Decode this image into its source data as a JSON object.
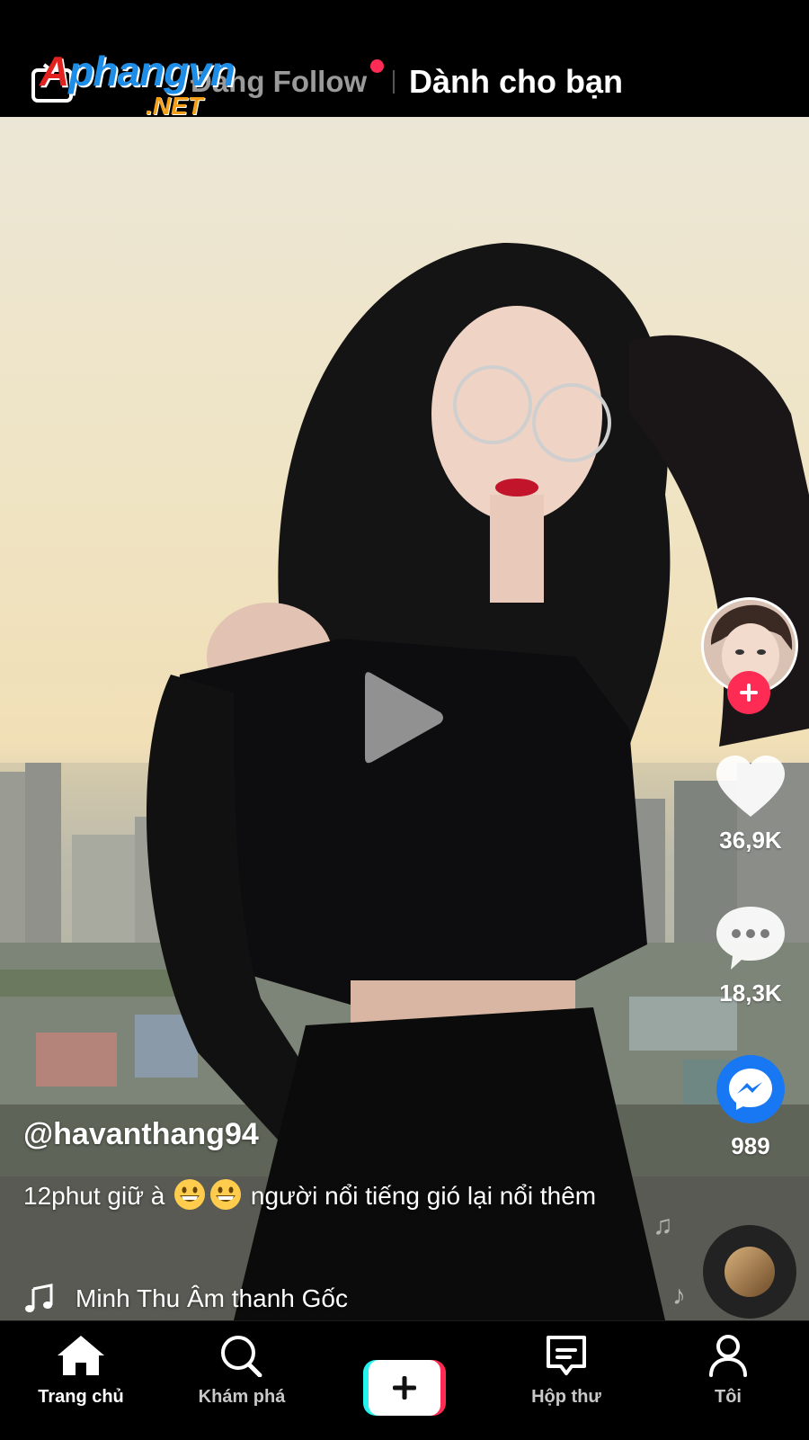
{
  "top_nav": {
    "following_label": "Đang Follow",
    "for_you_label": "Dành cho bạn",
    "live_icon": "live-tv-icon"
  },
  "watermark": {
    "main_first": "A",
    "main_rest": "phangvn",
    "sub": ".NET"
  },
  "video": {
    "state": "paused",
    "play_icon": "play-icon"
  },
  "side_actions": {
    "avatar": "creator-avatar",
    "follow_icon": "plus-icon",
    "like_count": "36,9K",
    "comment_count": "18,3K",
    "share_count": "989"
  },
  "post": {
    "username": "@havanthang94",
    "caption_before": "12phut giữ à",
    "caption_after": "người nổi tiếng gió lại nổi thêm",
    "caption_emojis": [
      "grinning-face-emoji",
      "grinning-face-emoji"
    ],
    "music": "Minh Thu Âm thanh Gốc"
  },
  "bottom_nav": {
    "home": "Trang chủ",
    "explore": "Khám phá",
    "inbox": "Hộp thư",
    "me": "Tôi"
  },
  "colors": {
    "accent_red": "#fe2c55",
    "accent_cyan": "#25f4ee",
    "messenger_blue": "#1877f2",
    "background": "#000000"
  }
}
